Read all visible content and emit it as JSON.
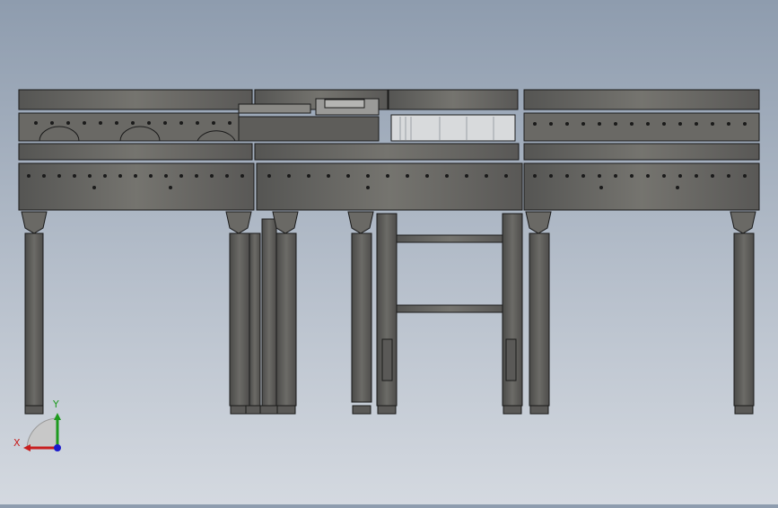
{
  "view": {
    "background_top": "#8e9cae",
    "background_bottom": "#d4d9e0",
    "frame_color": "#5c5c5a",
    "frame_light": "#7a7a76",
    "edge_color": "#1a1a1a"
  },
  "triad": {
    "x_label": "X",
    "y_label": "Y",
    "x_color": "#c81e1e",
    "y_color": "#1e9a1e",
    "z_color": "#1a1acc"
  }
}
